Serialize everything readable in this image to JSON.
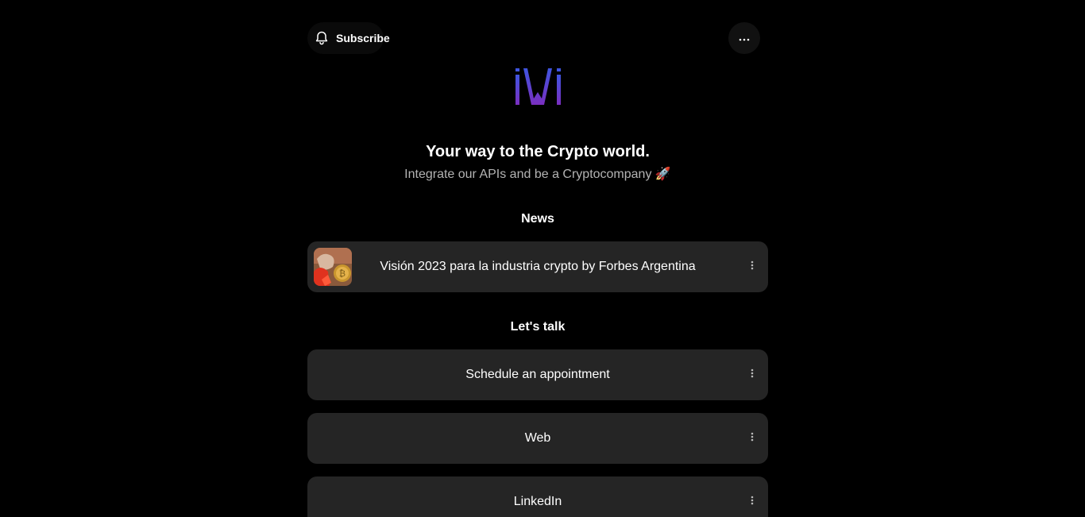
{
  "header": {
    "subscribe_label": "Subscribe",
    "bell_icon": "bell-icon",
    "more_icon": "more-horizontal-icon"
  },
  "profile": {
    "logo_icon": "ivi-logo",
    "title": "Your way to the Crypto world.",
    "subtitle": "Integrate our APIs and be a Cryptocompany 🚀"
  },
  "sections": {
    "news": {
      "heading": "News",
      "items": [
        {
          "label": "Visión 2023 para la industria crypto by Forbes Argentina",
          "thumbnail": "bitcoin-news-thumbnail"
        }
      ]
    },
    "talk": {
      "heading": "Let's talk",
      "items": [
        {
          "label": "Schedule an appointment"
        },
        {
          "label": "Web"
        },
        {
          "label": "LinkedIn"
        }
      ]
    }
  },
  "colors": {
    "background": "#000000",
    "card": "#252525",
    "subtitle": "#b3b3b3",
    "logo_gradient_start": "#6a2fc9",
    "logo_gradient_end": "#3a4fd8"
  }
}
